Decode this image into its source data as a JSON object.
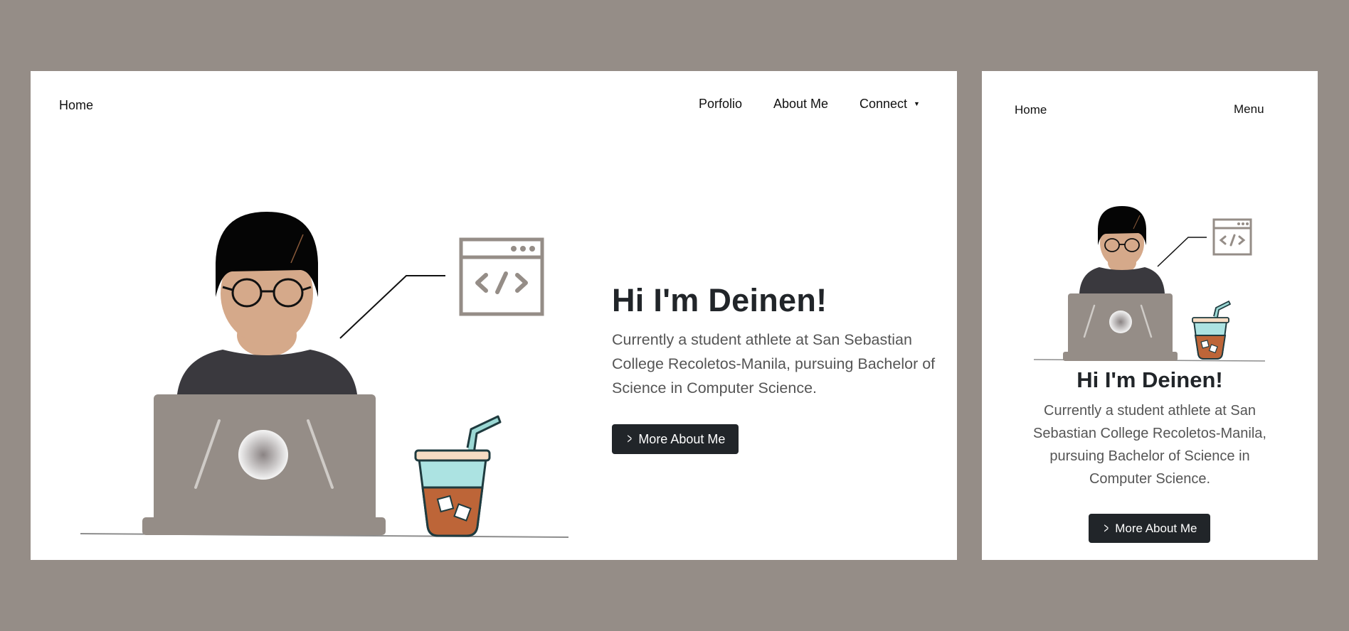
{
  "desktop": {
    "nav": {
      "home": "Home",
      "portfolio": "Porfolio",
      "about": "About Me",
      "connect": "Connect",
      "connect_caret": "▼"
    },
    "hero": {
      "title": "Hi I'm Deinen!",
      "description": "Currently a student athlete at San Sebastian College Recoletos-Manila, pursuing Bachelor of Science in Computer Science.",
      "button_label": "More About Me",
      "button_icon": "chevron-right-icon"
    }
  },
  "mobile": {
    "nav": {
      "home": "Home",
      "menu": "Menu"
    },
    "hero": {
      "title": "Hi I'm Deinen!",
      "description": "Currently a student athlete at San Sebastian College Recoletos-Manila, pursuing Bachelor of Science in Computer Science.",
      "button_label": "More About Me",
      "button_icon": "chevron-right-icon"
    }
  },
  "colors": {
    "background": "#958d87",
    "panel": "#ffffff",
    "button": "#212529",
    "laptop": "#958d87",
    "shirt": "#3a393e",
    "skin": "#d5a98a",
    "drink": "#bd6538",
    "glass": "#ace3e2"
  }
}
